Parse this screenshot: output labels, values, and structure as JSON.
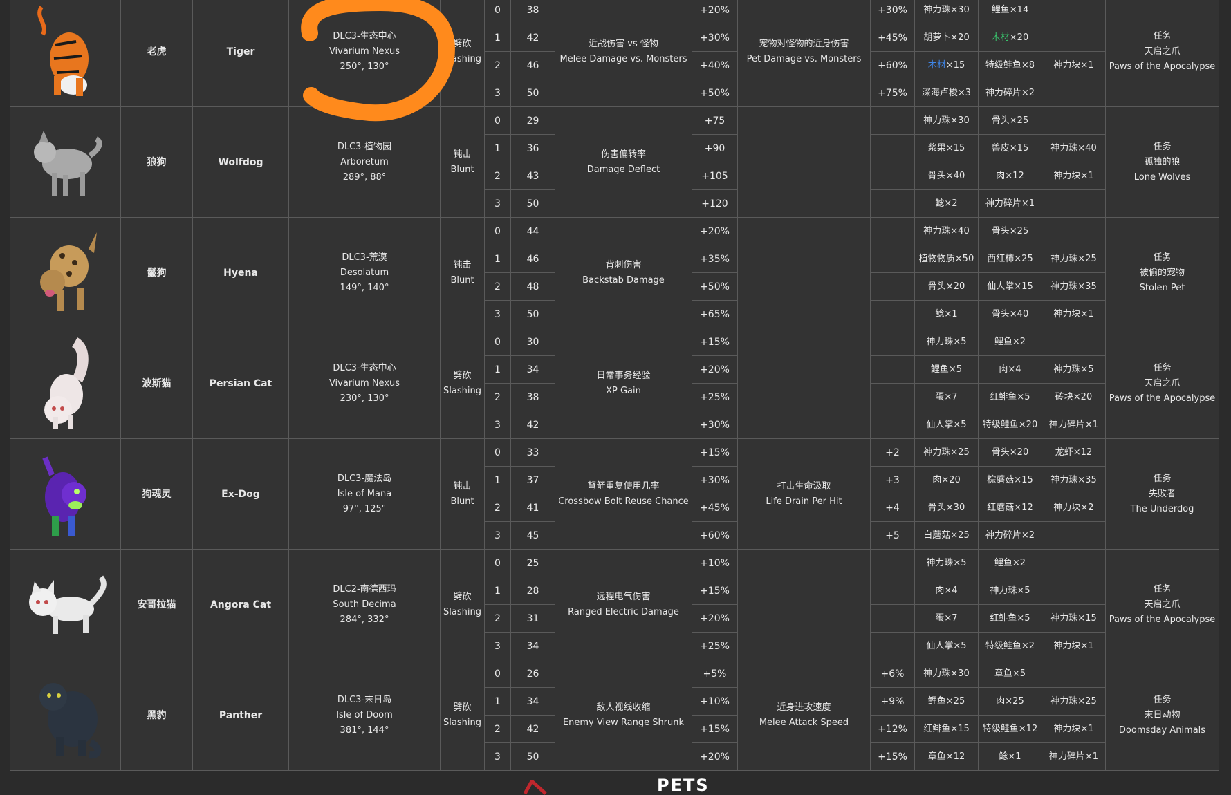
{
  "pets": [
    {
      "cn": "老虎",
      "en": "Tiger",
      "location": [
        "DLC3-生态中心",
        "Vivarium Nexus",
        "250°, 130°"
      ],
      "damage": [
        "劈砍",
        "Slashing"
      ],
      "levels": [
        "0",
        "1",
        "2",
        "3"
      ],
      "base": [
        "38",
        "42",
        "46",
        "50"
      ],
      "skill1": [
        "近战伤害 vs 怪物",
        "Melee Damage vs. Monsters"
      ],
      "skill1_vals": [
        "+20%",
        "+30%",
        "+40%",
        "+50%"
      ],
      "skill2": [
        "宠物对怪物的近身伤害",
        "Pet Damage vs. Monsters"
      ],
      "skill2_vals": [
        "+30%",
        "+45%",
        "+60%",
        "+75%"
      ],
      "food": [
        [
          "神力珠×30",
          "鲤鱼×14",
          ""
        ],
        [
          "胡萝卜×20",
          "木材×20",
          ""
        ],
        [
          "木材×15",
          "特级鲑鱼×8",
          "神力块×1"
        ],
        [
          "深海卢梭×3",
          "神力碎片×2",
          ""
        ]
      ],
      "quest": [
        "任务",
        "天启之爪",
        "Paws of the Apocalypse"
      ]
    },
    {
      "cn": "狼狗",
      "en": "Wolfdog",
      "location": [
        "DLC3-植物园",
        "Arboretum",
        "289°, 88°"
      ],
      "damage": [
        "钝击",
        "Blunt"
      ],
      "levels": [
        "0",
        "1",
        "2",
        "3"
      ],
      "base": [
        "29",
        "36",
        "43",
        "50"
      ],
      "skill1": [
        "伤害偏转率",
        "Damage Deflect"
      ],
      "skill1_vals": [
        "+75",
        "+90",
        "+105",
        "+120"
      ],
      "skill2": [],
      "skill2_vals": [
        "",
        "",
        "",
        ""
      ],
      "food": [
        [
          "神力珠×30",
          "骨头×25",
          ""
        ],
        [
          "浆果×15",
          "兽皮×15",
          "神力珠×40"
        ],
        [
          "骨头×40",
          "肉×12",
          "神力块×1"
        ],
        [
          "鲶×2",
          "神力碎片×1",
          ""
        ]
      ],
      "quest": [
        "任务",
        "孤独的狼",
        "Lone Wolves"
      ]
    },
    {
      "cn": "鬣狗",
      "en": "Hyena",
      "location": [
        "DLC3-荒漠",
        "Desolatum",
        "149°, 140°"
      ],
      "damage": [
        "钝击",
        "Blunt"
      ],
      "levels": [
        "0",
        "1",
        "2",
        "3"
      ],
      "base": [
        "44",
        "46",
        "48",
        "50"
      ],
      "skill1": [
        "背刺伤害",
        "Backstab Damage"
      ],
      "skill1_vals": [
        "+20%",
        "+35%",
        "+50%",
        "+65%"
      ],
      "skill2": [],
      "skill2_vals": [
        "",
        "",
        "",
        ""
      ],
      "food": [
        [
          "神力珠×40",
          "骨头×25",
          ""
        ],
        [
          "植物物质×50",
          "西红柿×25",
          "神力珠×25"
        ],
        [
          "骨头×20",
          "仙人掌×15",
          "神力珠×35"
        ],
        [
          "鲶×1",
          "骨头×40",
          "神力块×1"
        ]
      ],
      "quest": [
        "任务",
        "被偷的宠物",
        "Stolen Pet"
      ]
    },
    {
      "cn": "波斯猫",
      "en": "Persian Cat",
      "location": [
        "DLC3-生态中心",
        "Vivarium Nexus",
        "230°, 130°"
      ],
      "damage": [
        "劈砍",
        "Slashing"
      ],
      "levels": [
        "0",
        "1",
        "2",
        "3"
      ],
      "base": [
        "30",
        "34",
        "38",
        "42"
      ],
      "skill1": [
        "日常事务经验",
        "XP Gain"
      ],
      "skill1_vals": [
        "+15%",
        "+20%",
        "+25%",
        "+30%"
      ],
      "skill2": [],
      "skill2_vals": [
        "",
        "",
        "",
        ""
      ],
      "food": [
        [
          "神力珠×5",
          "鲤鱼×2",
          ""
        ],
        [
          "鲤鱼×5",
          "肉×4",
          "神力珠×5"
        ],
        [
          "蛋×7",
          "红鲱鱼×5",
          "砖块×20"
        ],
        [
          "仙人掌×5",
          "特级鲑鱼×20",
          "神力碎片×1"
        ]
      ],
      "quest": [
        "任务",
        "天启之爪",
        "Paws of the Apocalypse"
      ]
    },
    {
      "cn": "狗魂灵",
      "en": "Ex-Dog",
      "location": [
        "DLC3-魔法岛",
        "Isle of Mana",
        "97°, 125°"
      ],
      "damage": [
        "钝击",
        "Blunt"
      ],
      "levels": [
        "0",
        "1",
        "2",
        "3"
      ],
      "base": [
        "33",
        "37",
        "41",
        "45"
      ],
      "skill1": [
        "弩箭重复使用几率",
        "Crossbow Bolt Reuse Chance"
      ],
      "skill1_vals": [
        "+15%",
        "+30%",
        "+45%",
        "+60%"
      ],
      "skill2": [
        "打击生命汲取",
        "Life Drain Per Hit"
      ],
      "skill2_vals": [
        "+2",
        "+3",
        "+4",
        "+5"
      ],
      "food": [
        [
          "神力珠×25",
          "骨头×20",
          "龙虾×12"
        ],
        [
          "肉×20",
          "棕蘑菇×15",
          "神力珠×35"
        ],
        [
          "骨头×30",
          "红蘑菇×12",
          "神力块×2"
        ],
        [
          "白蘑菇×25",
          "神力碎片×2",
          ""
        ]
      ],
      "quest": [
        "任务",
        "失败者",
        "The Underdog"
      ]
    },
    {
      "cn": "安哥拉猫",
      "en": "Angora Cat",
      "location": [
        "DLC2-南德西玛",
        "South Decima",
        "284°, 332°"
      ],
      "damage": [
        "劈砍",
        "Slashing"
      ],
      "levels": [
        "0",
        "1",
        "2",
        "3"
      ],
      "base": [
        "25",
        "28",
        "31",
        "34"
      ],
      "skill1": [
        "远程电气伤害",
        "Ranged Electric Damage"
      ],
      "skill1_vals": [
        "+10%",
        "+15%",
        "+20%",
        "+25%"
      ],
      "skill2": [],
      "skill2_vals": [
        "",
        "",
        "",
        ""
      ],
      "food": [
        [
          "神力珠×5",
          "鲤鱼×2",
          ""
        ],
        [
          "肉×4",
          "神力珠×5",
          ""
        ],
        [
          "蛋×7",
          "红鲱鱼×5",
          "神力珠×15"
        ],
        [
          "仙人掌×5",
          "特级鲑鱼×2",
          "神力块×1"
        ]
      ],
      "quest": [
        "任务",
        "天启之爪",
        "Paws of the Apocalypse"
      ]
    },
    {
      "cn": "黑豹",
      "en": "Panther",
      "location": [
        "DLC3-末日岛",
        "Isle of Doom",
        "381°, 144°"
      ],
      "damage": [
        "劈砍",
        "Slashing"
      ],
      "levels": [
        "0",
        "1",
        "2",
        "3"
      ],
      "base": [
        "26",
        "34",
        "42",
        "50"
      ],
      "skill1": [
        "敌人视线收缩",
        "Enemy View Range Shrunk"
      ],
      "skill1_vals": [
        "+5%",
        "+10%",
        "+15%",
        "+20%"
      ],
      "skill2": [
        "近身进攻速度",
        "Melee Attack Speed"
      ],
      "skill2_vals": [
        "+6%",
        "+9%",
        "+12%",
        "+15%"
      ],
      "food": [
        [
          "神力珠×30",
          "章鱼×5",
          ""
        ],
        [
          "鲤鱼×25",
          "肉×25",
          "神力珠×25"
        ],
        [
          "红鲱鱼×15",
          "特级鲑鱼×12",
          "神力块×1"
        ],
        [
          "章鱼×12",
          "鲶×1",
          "神力碎片×1"
        ]
      ],
      "quest": [
        "任务",
        "末日动物",
        "Doomsday Animals"
      ]
    }
  ],
  "footer": {
    "logo_text": "PETS"
  },
  "colors": {
    "background": "#2b2b2b",
    "cell": "#333333",
    "border": "#5a5a5a",
    "text": "#e8e8e8",
    "annotation": "#ff8a1c",
    "highlight_green": "#39c06b",
    "highlight_blue": "#3f86e8"
  },
  "icons": [
    "tiger-image",
    "wolfdog-image",
    "hyena-image",
    "persian-cat-image",
    "ex-dog-image",
    "angora-cat-image",
    "panther-image"
  ]
}
